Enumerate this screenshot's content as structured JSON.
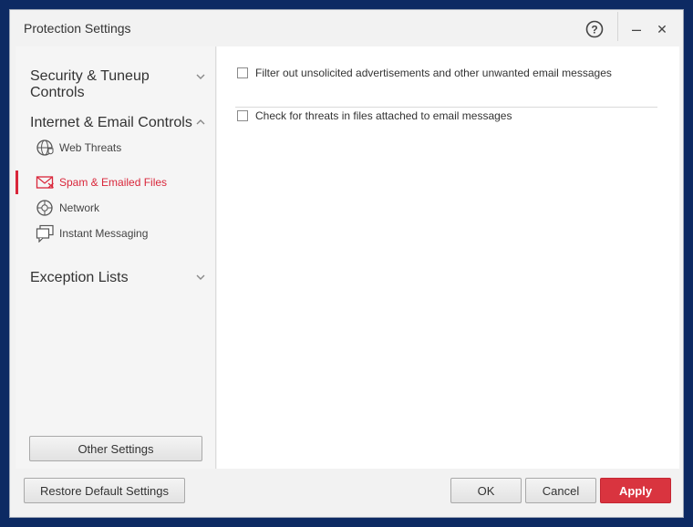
{
  "window": {
    "title": "Protection Settings"
  },
  "titlebar": {
    "help_icon": "help-circle-icon",
    "minimize_glyph": "–",
    "close_glyph": "✕"
  },
  "sidebar": {
    "sections": [
      {
        "label_line1": "Security & Tuneup",
        "label_line2": "Controls",
        "expanded": false
      },
      {
        "label": "Internet & Email Controls",
        "expanded": true,
        "items": [
          {
            "label": "Web Threats",
            "icon": "globe-shield-icon"
          },
          {
            "label": "Spam & Emailed Files",
            "icon": "envelope-icon",
            "active": true
          },
          {
            "label": "Network",
            "icon": "network-globe-icon"
          },
          {
            "label": "Instant Messaging",
            "icon": "chat-bubbles-icon"
          }
        ]
      },
      {
        "label": "Exception Lists",
        "expanded": false
      }
    ],
    "other_settings_label": "Other Settings"
  },
  "content": {
    "options": [
      {
        "label": "Filter out unsolicited advertisements and other unwanted email messages",
        "checked": false
      },
      {
        "label": "Check for threats in files attached to email messages",
        "checked": false
      }
    ]
  },
  "footer": {
    "restore_label": "Restore Default Settings",
    "ok_label": "OK",
    "cancel_label": "Cancel",
    "apply_label": "Apply"
  },
  "colors": {
    "accent": "#d9263a",
    "apply_bg": "#d9343f",
    "desktop": "#0d2a63"
  }
}
